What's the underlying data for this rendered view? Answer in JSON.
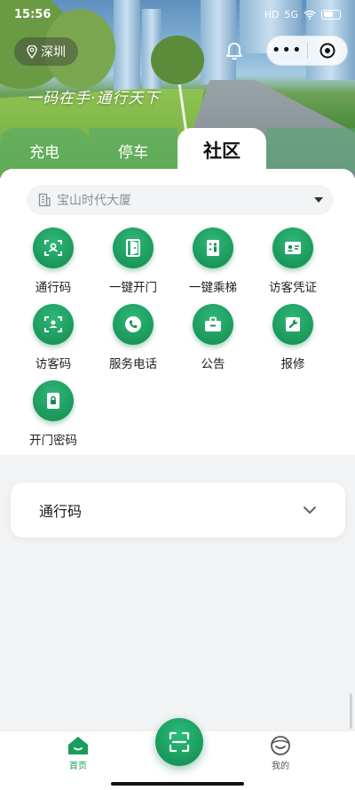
{
  "status_bar": {
    "time": "15:56",
    "network": "5G",
    "signal": "HD"
  },
  "header": {
    "city": "深圳",
    "slogan": "一码在手·通行天下",
    "capsule_more": "•••"
  },
  "tabs": [
    {
      "label": "充电",
      "active": false
    },
    {
      "label": "停车",
      "active": false
    },
    {
      "label": "社区",
      "active": true
    },
    {
      "label": "",
      "active": false
    }
  ],
  "building_selector": {
    "value": "宝山时代大厦"
  },
  "services": [
    {
      "label": "通行码",
      "icon": "pass-code-icon"
    },
    {
      "label": "一键开门",
      "icon": "door-icon"
    },
    {
      "label": "一键乘梯",
      "icon": "elevator-icon"
    },
    {
      "label": "访客凭证",
      "icon": "visitor-card-icon"
    },
    {
      "label": "访客码",
      "icon": "visitor-code-icon"
    },
    {
      "label": "服务电话",
      "icon": "phone-icon"
    },
    {
      "label": "公告",
      "icon": "notice-icon"
    },
    {
      "label": "报修",
      "icon": "repair-icon"
    },
    {
      "label": "开门密码",
      "icon": "door-password-icon"
    }
  ],
  "pass_card": {
    "title": "通行码"
  },
  "bottom_nav": {
    "home_label": "首页",
    "mine_label": "我的"
  },
  "colors": {
    "brand_green": "#1a9c5c",
    "tab_green": "#50aa6e"
  }
}
